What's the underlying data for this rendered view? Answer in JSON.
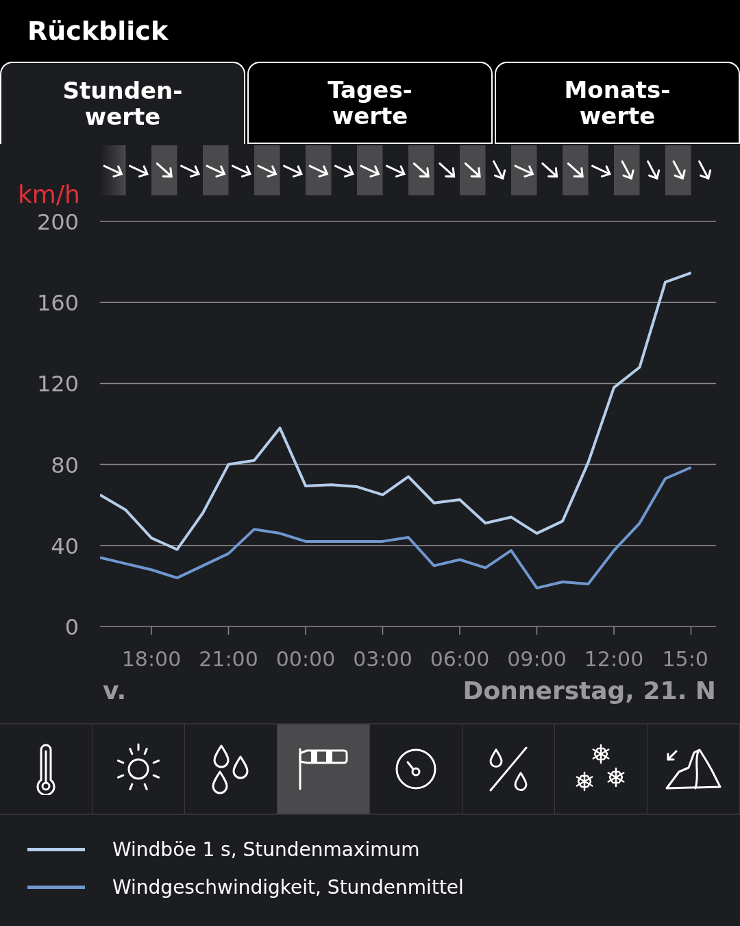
{
  "title": "Rückblick",
  "tabs": [
    {
      "label": "Stunden-\nwerte",
      "selected": true
    },
    {
      "label": "Tages-\nwerte",
      "selected": false
    },
    {
      "label": "Monats-\nwerte",
      "selected": false
    }
  ],
  "wind_arrows": [
    {
      "kind": "wnw"
    },
    {
      "kind": "wnw"
    },
    {
      "kind": "nw"
    },
    {
      "kind": "wnw"
    },
    {
      "kind": "wnw"
    },
    {
      "kind": "wnw"
    },
    {
      "kind": "wnw"
    },
    {
      "kind": "wnw"
    },
    {
      "kind": "wnw"
    },
    {
      "kind": "wnw"
    },
    {
      "kind": "wnw"
    },
    {
      "kind": "wnw"
    },
    {
      "kind": "nw"
    },
    {
      "kind": "nw"
    },
    {
      "kind": "nw"
    },
    {
      "kind": "nnw"
    },
    {
      "kind": "wnw"
    },
    {
      "kind": "nw"
    },
    {
      "kind": "nw"
    },
    {
      "kind": "wnw"
    },
    {
      "kind": "nnw"
    },
    {
      "kind": "nnw"
    },
    {
      "kind": "nnw"
    },
    {
      "kind": "nnw"
    }
  ],
  "chart_data": {
    "type": "line",
    "ylabel": "km/h",
    "categories": [
      null,
      null,
      "18:00",
      null,
      null,
      "21:00",
      null,
      null,
      "00:00",
      null,
      null,
      "03:00",
      null,
      null,
      "06:00",
      null,
      null,
      "09:00",
      null,
      null,
      "12:00",
      null,
      null,
      "15:0"
    ],
    "ylim": [
      0,
      200
    ],
    "grid": true,
    "yticks": [
      0,
      40,
      80,
      120,
      160,
      200
    ],
    "series": [
      {
        "name": "Windböe 1 s, Stundenmaximum",
        "color": "#b4cdea",
        "values": [
          65,
          57.5,
          43.7,
          38,
          56,
          80,
          82,
          98,
          69.4,
          70,
          69,
          65,
          74,
          61,
          62.6,
          51,
          54,
          46,
          52,
          81,
          118,
          128,
          170,
          174.6
        ]
      },
      {
        "name": "Windgeschwindigkeit, Stundenmittel",
        "color": "#6f98d0",
        "values": [
          34,
          31,
          28,
          24,
          30,
          36,
          48,
          46,
          42,
          42,
          42,
          42,
          44,
          30,
          33,
          29,
          37.5,
          19,
          22,
          21,
          37.5,
          51,
          73,
          78.5
        ]
      }
    ]
  },
  "date_labels": [
    "v.",
    "Donnerstag, 21. N"
  ],
  "parameter_buttons": [
    {
      "kind": "temperature",
      "selected": false
    },
    {
      "kind": "sunshine",
      "selected": false
    },
    {
      "kind": "precipitation",
      "selected": false
    },
    {
      "kind": "wind",
      "selected": true
    },
    {
      "kind": "pressure",
      "selected": false
    },
    {
      "kind": "humidity",
      "selected": false
    },
    {
      "kind": "snow",
      "selected": false
    },
    {
      "kind": "foehn",
      "selected": false
    }
  ]
}
